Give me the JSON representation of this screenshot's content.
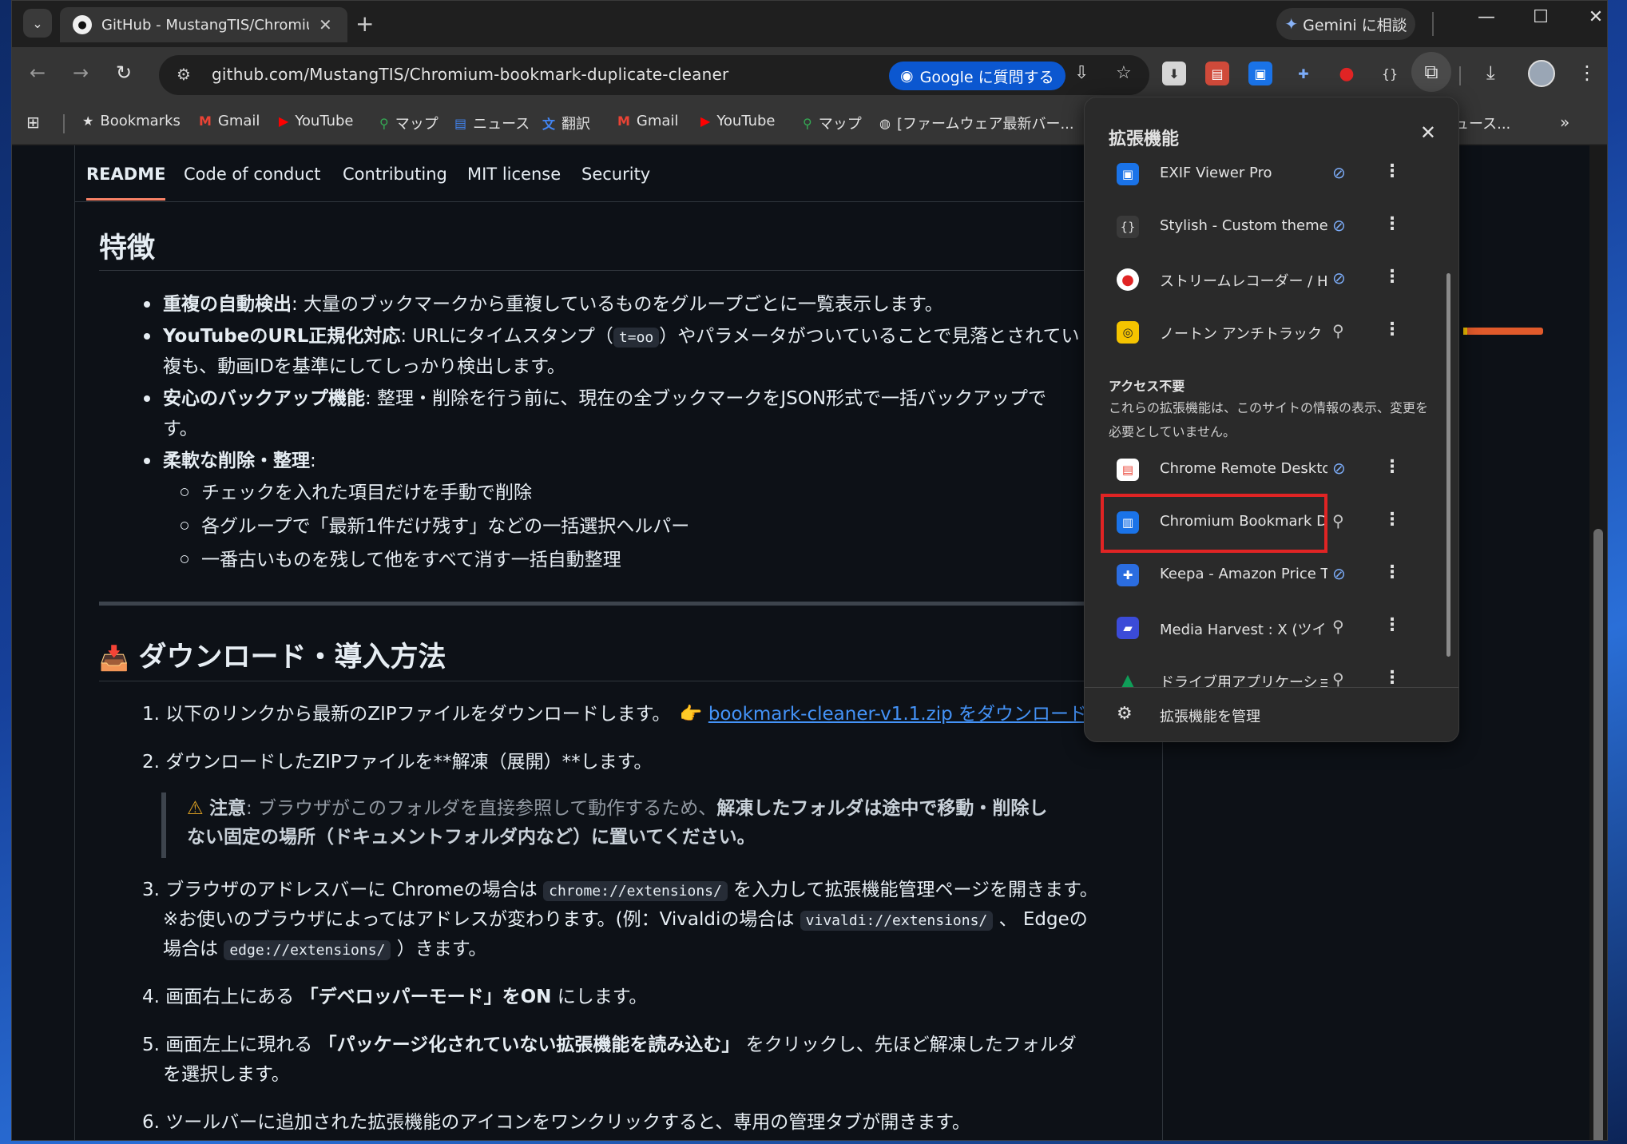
{
  "browser": {
    "tab_title": "GitHub - MustangTIS/Chromium-bookmark-duplicate-cleaner",
    "new_tab": "+",
    "gemini_label": "Gemini に相談",
    "url": "github.com/MustangTIS/Chromium-bookmark-duplicate-cleaner",
    "google_ask": "Google に質問する"
  },
  "bookmarks": [
    {
      "label": "Bookmarks",
      "icon": "star-icon"
    },
    {
      "label": "Gmail",
      "icon": "gmail-icon"
    },
    {
      "label": "YouTube",
      "icon": "youtube-icon"
    },
    {
      "label": "マップ",
      "icon": "maps-icon"
    },
    {
      "label": "ニュース",
      "icon": "news-icon"
    },
    {
      "label": "翻訳",
      "icon": "translate-icon"
    },
    {
      "label": "Gmail",
      "icon": "gmail-icon"
    },
    {
      "label": "YouTube",
      "icon": "youtube-icon"
    },
    {
      "label": "マップ",
      "icon": "maps-icon"
    },
    {
      "label": "[ファームウェア最新バー...",
      "icon": "globe-icon"
    },
    {
      "label": "ュース..."
    }
  ],
  "repo_tabs": [
    "README",
    "Code of conduct",
    "Contributing",
    "MIT license",
    "Security"
  ],
  "features": {
    "heading": "特徴",
    "items": [
      {
        "bold": "重複の自動検出",
        "text": ": 大量のブックマークから重複しているものをグループごとに一覧表示します。"
      },
      {
        "bold": "YouTubeのURL正規化対応",
        "text1": ": URLにタイムスタンプ（",
        "code": "t=oo",
        "text2": "）やパラメータがついていることで見落とされてい",
        "cont": "複も、動画IDを基準にしてしっかり検出します。"
      },
      {
        "bold": "安心のバックアップ機能",
        "text": ": 整理・削除を行う前に、現在の全ブックマークをJSON形式で一括バックアップで",
        "cont": "す。"
      },
      {
        "bold": "柔軟な削除・整理",
        "text": ":"
      }
    ],
    "subitems": [
      "チェックを入れた項目だけを手動で削除",
      "各グループで「最新1件だけ残す」などの一括選択ヘルパー",
      "一番古いものを残して他をすべて消す一括自動整理"
    ]
  },
  "download": {
    "icon": "📥",
    "heading": "ダウンロード・導入方法",
    "step1_text": "以下のリンクから最新のZIPファイルをダウンロードします。",
    "step1_point": "👉",
    "step1_link": "bookmark-cleaner-v1.1.zip をダウンロード",
    "step2": "ダウンロードしたZIPファイルを**解凍（展開）**します。",
    "note_label": "注意",
    "note_text1": ": ブラウザがこのフォルダを直接参照して動作するため、",
    "note_bold1": "解凍したフォルダは途中で移動・削除し",
    "note_bold2": "ない固定の場所（ドキュメントフォルダ内など）に置いてください。",
    "step3_a": "ブラウザのアドレスバーに Chromeの場合は",
    "step3_code1": "chrome://extensions/",
    "step3_b": "を入力して拡張機能管理ページを開きます。",
    "step3_c": "※お使いのブラウザによってはアドレスが変わります。(例：Vivaldiの場合は",
    "step3_code2": "vivaldi://extensions/",
    "step3_d": "、 Edgeの",
    "step3_e": "場合は",
    "step3_code3": "edge://extensions/",
    "step3_f": "）きます。",
    "step4_a": "画面右上にある",
    "step4_b": "「デベロッパーモード」をON",
    "step4_c": "にします。",
    "step5_a": "画面左上に現れる",
    "step5_b": "「パッケージ化されていない拡張機能を読み込む」",
    "step5_c": "をクリックし、先ほど解凍したフォルダ",
    "step5_d": "を選択します。",
    "step6": "ツールバーに追加された拡張機能のアイコンをワンクリックすると、専用の管理タブが開きます。"
  },
  "popup": {
    "title": "拡張機能",
    "close": "✕",
    "access_items": [
      {
        "name": "EXIF Viewer Pro",
        "pinned": true,
        "icon": "exif-icon",
        "color": "#1a73e8"
      },
      {
        "name": "Stylish - Custom theme...",
        "pinned": true,
        "icon": "stylish-icon",
        "color": "#3a3a3a"
      },
      {
        "name": "ストリームレコーダー / HLS...",
        "pinned": true,
        "icon": "record-icon",
        "color": "#ffffff"
      },
      {
        "name": "ノートン アンチトラック",
        "pinned": false,
        "icon": "norton-icon",
        "color": "#f5c400"
      }
    ],
    "no_access_heading": "アクセス不要",
    "no_access_desc": "これらの拡張機能は、このサイトの情報の表示、変更を必要としていません。",
    "no_access_items": [
      {
        "name": "Chrome Remote Desktop",
        "pinned": true,
        "icon": "remote-desktop-icon",
        "color": "#ea4335"
      },
      {
        "name": "Chromium Bookmark D...",
        "pinned": false,
        "icon": "bookmark-cleaner-icon",
        "color": "#1a73e8"
      },
      {
        "name": "Keepa - Amazon Price T...",
        "pinned": true,
        "icon": "keepa-icon",
        "color": "#2b6de0"
      },
      {
        "name": "Media Harvest : X (ツイッ...",
        "pinned": false,
        "icon": "media-harvest-icon",
        "color": "#3b4bd8"
      },
      {
        "name": "ドライブ用アプリケーション...",
        "pinned": false,
        "icon": "drive-icon",
        "color": "#0f9d58"
      }
    ],
    "manage_label": "拡張機能を管理"
  }
}
